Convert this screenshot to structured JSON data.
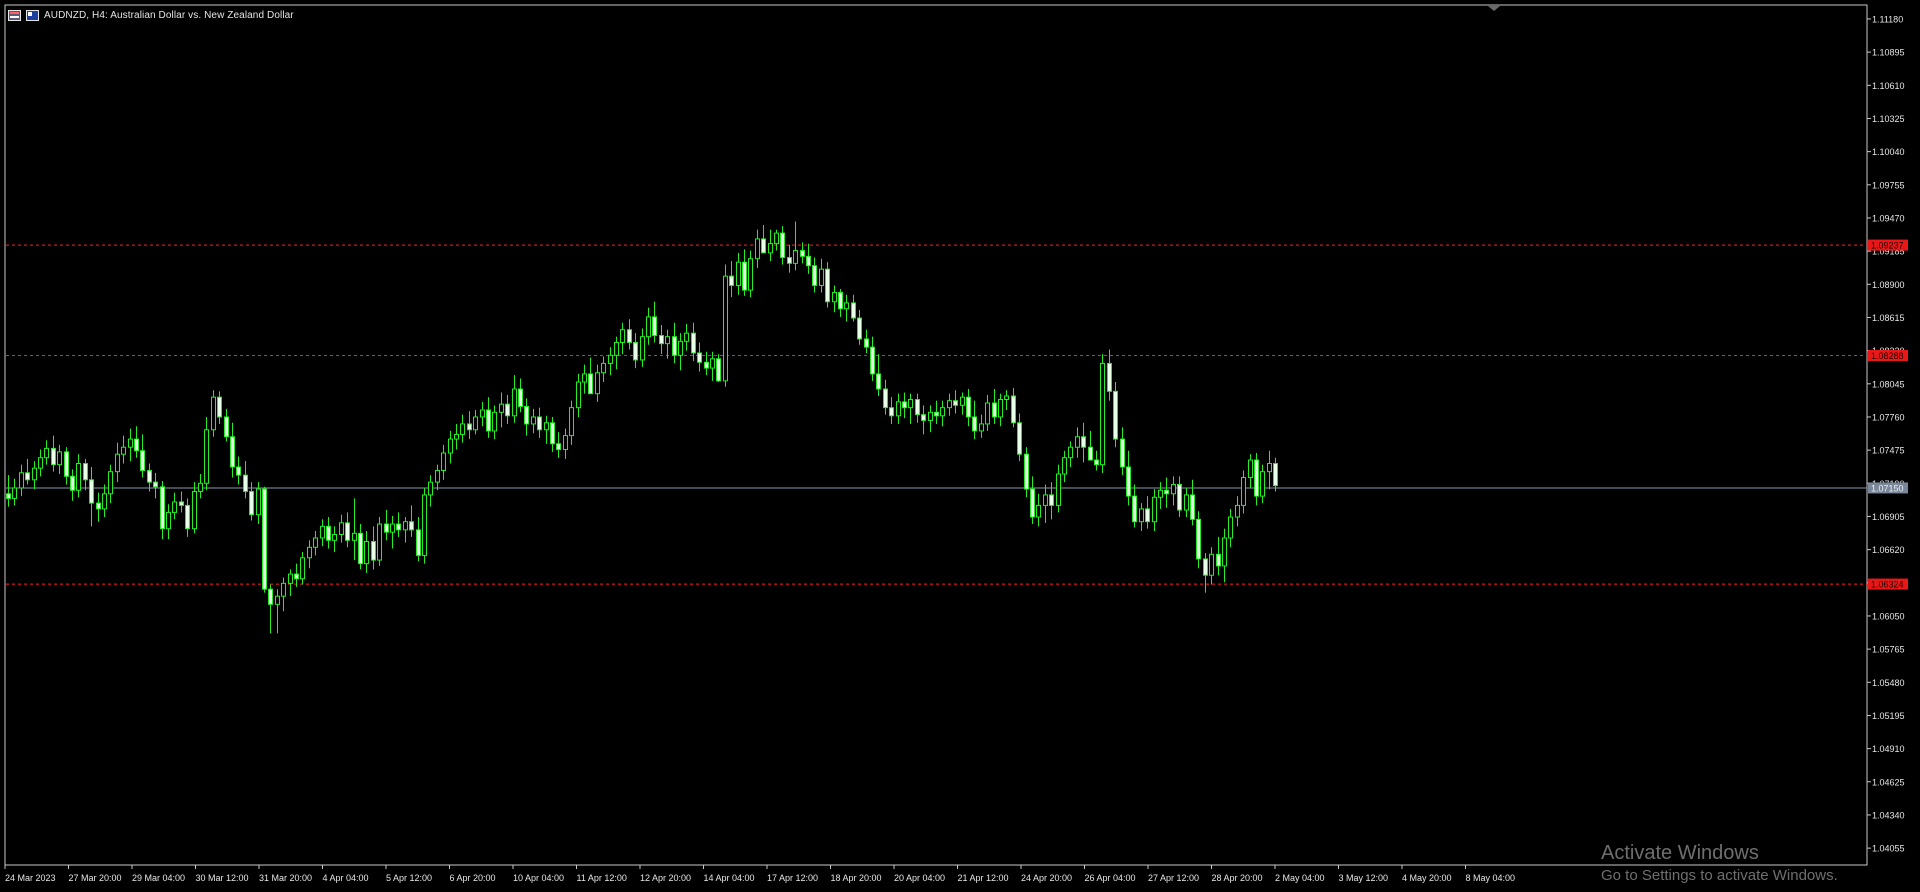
{
  "header": {
    "title": "AUDNZD, H4:  Australian Dollar vs. New Zealand Dollar",
    "icons": [
      "chart-window-icon",
      "symbol-icon"
    ]
  },
  "watermark": {
    "line1": "Activate Windows",
    "line2": "Go to Settings to activate Windows."
  },
  "colors": {
    "background": "#000000",
    "frame": "#c8c8c8",
    "candle": "#22ee22",
    "candle_up_fill": "#000000",
    "candle_down_fill": "#e8ffe8",
    "level_line": "#ff1f1f",
    "bid_line": "#8899aa"
  },
  "chart_data": {
    "type": "candlestick",
    "symbol": "AUDNZD",
    "timeframe": "H4",
    "ylim": [
      1.0391,
      1.113
    ],
    "y_ticks": [
      "1.11180",
      "1.10895",
      "1.10610",
      "1.10325",
      "1.10040",
      "1.09755",
      "1.09470",
      "1.09185",
      "1.08900",
      "1.08615",
      "1.08330",
      "1.08045",
      "1.07760",
      "1.07475",
      "1.07190",
      "1.06905",
      "1.06620",
      "1.06335",
      "1.06050",
      "1.05765",
      "1.05480",
      "1.05195",
      "1.04910",
      "1.04625",
      "1.04340",
      "1.04055"
    ],
    "x_ticks": [
      "24 Mar 2023",
      "27 Mar 20:00",
      "29 Mar 04:00",
      "30 Mar 12:00",
      "31 Mar 20:00",
      "4 Apr 04:00",
      "5 Apr 12:00",
      "6 Apr 20:00",
      "10 Apr 04:00",
      "11 Apr 12:00",
      "12 Apr 20:00",
      "14 Apr 04:00",
      "17 Apr 12:00",
      "18 Apr 20:00",
      "20 Apr 04:00",
      "21 Apr 12:00",
      "24 Apr 20:00",
      "26 Apr 04:00",
      "27 Apr 12:00",
      "28 Apr 20:00",
      "2 May 04:00",
      "3 May 12:00",
      "4 May 20:00",
      "8 May 04:00"
    ],
    "current_price": "1.07150",
    "levels": [
      {
        "label": "1.09237",
        "value": 1.09237
      },
      {
        "label": "1.08288",
        "value": 1.08288
      },
      {
        "label": "1.06324",
        "value": 1.06324
      }
    ],
    "candles": [
      [
        1.071,
        1.0726,
        1.0699,
        1.0706
      ],
      [
        1.0706,
        1.0723,
        1.07,
        1.0715
      ],
      [
        1.0715,
        1.0735,
        1.0708,
        1.0728
      ],
      [
        1.0728,
        1.074,
        1.0718,
        1.0722
      ],
      [
        1.0722,
        1.0738,
        1.0714,
        1.0732
      ],
      [
        1.0732,
        1.0748,
        1.0725,
        1.0741
      ],
      [
        1.0741,
        1.0756,
        1.0735,
        1.0749
      ],
      [
        1.0749,
        1.076,
        1.0729,
        1.0735
      ],
      [
        1.0735,
        1.0752,
        1.0727,
        1.0746
      ],
      [
        1.0746,
        1.075,
        1.0718,
        1.0725
      ],
      [
        1.0725,
        1.0731,
        1.0704,
        1.0713
      ],
      [
        1.0713,
        1.0744,
        1.0707,
        1.0736
      ],
      [
        1.0736,
        1.074,
        1.0713,
        1.0722
      ],
      [
        1.0722,
        1.0733,
        1.0682,
        1.0702
      ],
      [
        1.0702,
        1.0711,
        1.0686,
        1.0697
      ],
      [
        1.0697,
        1.0718,
        1.069,
        1.071
      ],
      [
        1.071,
        1.0735,
        1.0702,
        1.0729
      ],
      [
        1.0729,
        1.0754,
        1.072,
        1.0744
      ],
      [
        1.0744,
        1.076,
        1.0736,
        1.075
      ],
      [
        1.075,
        1.0766,
        1.0738,
        1.0757
      ],
      [
        1.0757,
        1.0768,
        1.0741,
        1.0747
      ],
      [
        1.0747,
        1.0761,
        1.0724,
        1.073
      ],
      [
        1.073,
        1.0736,
        1.0712,
        1.072
      ],
      [
        1.072,
        1.0728,
        1.0706,
        1.0716
      ],
      [
        1.0716,
        1.0721,
        1.0671,
        1.068
      ],
      [
        1.068,
        1.0701,
        1.0671,
        1.0694
      ],
      [
        1.0694,
        1.0711,
        1.0688,
        1.0703
      ],
      [
        1.0703,
        1.0712,
        1.0694,
        1.07
      ],
      [
        1.07,
        1.0706,
        1.0673,
        1.068
      ],
      [
        1.068,
        1.072,
        1.0676,
        1.0712
      ],
      [
        1.0712,
        1.0727,
        1.0706,
        1.0719
      ],
      [
        1.0719,
        1.0776,
        1.0713,
        1.0765
      ],
      [
        1.0765,
        1.0799,
        1.0759,
        1.0793
      ],
      [
        1.0793,
        1.0798,
        1.077,
        1.0776
      ],
      [
        1.0776,
        1.0783,
        1.0755,
        1.0759
      ],
      [
        1.0759,
        1.0771,
        1.0724,
        1.0733
      ],
      [
        1.0733,
        1.0742,
        1.0718,
        1.0726
      ],
      [
        1.0726,
        1.0738,
        1.0706,
        1.0712
      ],
      [
        1.0712,
        1.072,
        1.0687,
        1.0692
      ],
      [
        1.0692,
        1.072,
        1.0684,
        1.0714
      ],
      [
        1.0714,
        1.0716,
        1.0625,
        1.0628
      ],
      [
        1.0628,
        1.0632,
        1.059,
        1.0615
      ],
      [
        1.0615,
        1.0628,
        1.059,
        1.0622
      ],
      [
        1.0622,
        1.0638,
        1.0609,
        1.0633
      ],
      [
        1.0633,
        1.0645,
        1.0622,
        1.0641
      ],
      [
        1.0641,
        1.065,
        1.063,
        1.0637
      ],
      [
        1.0637,
        1.066,
        1.0632,
        1.0655
      ],
      [
        1.0655,
        1.067,
        1.0646,
        1.0664
      ],
      [
        1.0664,
        1.0678,
        1.0657,
        1.0672
      ],
      [
        1.0672,
        1.0688,
        1.0665,
        1.0682
      ],
      [
        1.0682,
        1.069,
        1.0663,
        1.067
      ],
      [
        1.067,
        1.0682,
        1.066,
        1.0675
      ],
      [
        1.0675,
        1.0692,
        1.0668,
        1.0685
      ],
      [
        1.0685,
        1.0694,
        1.0664,
        1.067
      ],
      [
        1.067,
        1.0706,
        1.0653,
        1.0676
      ],
      [
        1.0676,
        1.0684,
        1.0645,
        1.065
      ],
      [
        1.065,
        1.0678,
        1.0642,
        1.0669
      ],
      [
        1.0669,
        1.0682,
        1.0645,
        1.0653
      ],
      [
        1.0653,
        1.069,
        1.0648,
        1.0684
      ],
      [
        1.0684,
        1.0696,
        1.067,
        1.0677
      ],
      [
        1.0677,
        1.0691,
        1.0663,
        1.0684
      ],
      [
        1.0684,
        1.0694,
        1.0673,
        1.0679
      ],
      [
        1.0679,
        1.069,
        1.0668,
        1.0686
      ],
      [
        1.0686,
        1.07,
        1.0673,
        1.0679
      ],
      [
        1.0679,
        1.069,
        1.0652,
        1.0657
      ],
      [
        1.0657,
        1.0715,
        1.065,
        1.0709
      ],
      [
        1.0709,
        1.0726,
        1.0699,
        1.072
      ],
      [
        1.072,
        1.0735,
        1.0713,
        1.073
      ],
      [
        1.073,
        1.0752,
        1.0722,
        1.0745
      ],
      [
        1.0745,
        1.0764,
        1.0736,
        1.0757
      ],
      [
        1.0757,
        1.077,
        1.0748,
        1.0761
      ],
      [
        1.0761,
        1.0778,
        1.0754,
        1.077
      ],
      [
        1.077,
        1.0781,
        1.0757,
        1.0765
      ],
      [
        1.0765,
        1.0782,
        1.0761,
        1.0776
      ],
      [
        1.0776,
        1.0789,
        1.0768,
        1.0782
      ],
      [
        1.0782,
        1.0793,
        1.0758,
        1.0764
      ],
      [
        1.0764,
        1.0786,
        1.0757,
        1.078
      ],
      [
        1.078,
        1.0797,
        1.0767,
        1.0787
      ],
      [
        1.0787,
        1.0795,
        1.077,
        1.0777
      ],
      [
        1.0777,
        1.0812,
        1.0771,
        1.08
      ],
      [
        1.08,
        1.0809,
        1.078,
        1.0785
      ],
      [
        1.0785,
        1.0792,
        1.076,
        1.077
      ],
      [
        1.077,
        1.0783,
        1.0762,
        1.0776
      ],
      [
        1.0776,
        1.0784,
        1.0758,
        1.0765
      ],
      [
        1.0765,
        1.0777,
        1.0753,
        1.0771
      ],
      [
        1.0771,
        1.0776,
        1.0746,
        1.0753
      ],
      [
        1.0753,
        1.0763,
        1.0741,
        1.0748
      ],
      [
        1.0748,
        1.0766,
        1.074,
        1.076
      ],
      [
        1.076,
        1.079,
        1.0752,
        1.0784
      ],
      [
        1.0784,
        1.0813,
        1.0776,
        1.0806
      ],
      [
        1.0806,
        1.0821,
        1.0796,
        1.0813
      ],
      [
        1.0813,
        1.0827,
        1.0805,
        1.0796
      ],
      [
        1.0796,
        1.0821,
        1.0789,
        1.0814
      ],
      [
        1.0814,
        1.0828,
        1.0806,
        1.0822
      ],
      [
        1.0822,
        1.0836,
        1.0812,
        1.0829
      ],
      [
        1.0829,
        1.0845,
        1.0817,
        1.084
      ],
      [
        1.084,
        1.0857,
        1.083,
        1.0851
      ],
      [
        1.0851,
        1.086,
        1.0834,
        1.084
      ],
      [
        1.084,
        1.0848,
        1.0818,
        1.0825
      ],
      [
        1.0825,
        1.0852,
        1.0819,
        1.0845
      ],
      [
        1.0845,
        1.087,
        1.0838,
        1.0862
      ],
      [
        1.0862,
        1.0875,
        1.084,
        1.0846
      ],
      [
        1.0846,
        1.0855,
        1.083,
        1.0839
      ],
      [
        1.0839,
        1.0851,
        1.0826,
        1.0845
      ],
      [
        1.0845,
        1.0857,
        1.0822,
        1.0829
      ],
      [
        1.0829,
        1.0848,
        1.0816,
        1.0841
      ],
      [
        1.0841,
        1.0856,
        1.0833,
        1.0848
      ],
      [
        1.0848,
        1.0857,
        1.0824,
        1.0831
      ],
      [
        1.0831,
        1.084,
        1.0815,
        1.0823
      ],
      [
        1.0823,
        1.0832,
        1.0812,
        1.0818
      ],
      [
        1.0818,
        1.0832,
        1.0807,
        1.0826
      ],
      [
        1.0826,
        1.083,
        1.0806,
        1.0807
      ],
      [
        1.0807,
        1.0907,
        1.0802,
        1.0897
      ],
      [
        1.0897,
        1.091,
        1.0879,
        1.0889
      ],
      [
        1.0889,
        1.0917,
        1.0881,
        1.0909
      ],
      [
        1.0909,
        1.092,
        1.088,
        1.0885
      ],
      [
        1.0885,
        1.0919,
        1.0879,
        1.0912
      ],
      [
        1.0912,
        1.0937,
        1.0904,
        1.0929
      ],
      [
        1.0929,
        1.0941,
        1.0917,
        1.0917
      ],
      [
        1.0917,
        1.0937,
        1.091,
        1.0925
      ],
      [
        1.0925,
        1.0937,
        1.0919,
        1.0934
      ],
      [
        1.0934,
        1.094,
        1.0907,
        1.0913
      ],
      [
        1.0913,
        1.0924,
        1.09,
        1.0908
      ],
      [
        1.0908,
        1.0944,
        1.0902,
        1.0919
      ],
      [
        1.0919,
        1.0926,
        1.0908,
        1.0914
      ],
      [
        1.0914,
        1.0925,
        1.0899,
        1.0906
      ],
      [
        1.0906,
        1.0913,
        1.0883,
        1.0889
      ],
      [
        1.0889,
        1.0912,
        1.0883,
        1.0903
      ],
      [
        1.0903,
        1.0909,
        1.087,
        1.0875
      ],
      [
        1.0875,
        1.0889,
        1.0866,
        1.0883
      ],
      [
        1.0883,
        1.0886,
        1.0862,
        1.0869
      ],
      [
        1.0869,
        1.0881,
        1.0858,
        1.0874
      ],
      [
        1.0874,
        1.0881,
        1.0858,
        1.0861
      ],
      [
        1.0861,
        1.0868,
        1.0838,
        1.0843
      ],
      [
        1.0843,
        1.0851,
        1.0831,
        1.0836
      ],
      [
        1.0836,
        1.0845,
        1.0807,
        1.0813
      ],
      [
        1.0813,
        1.083,
        1.0794,
        1.08
      ],
      [
        1.08,
        1.0808,
        1.0778,
        1.0784
      ],
      [
        1.0784,
        1.0793,
        1.077,
        1.0777
      ],
      [
        1.0777,
        1.0796,
        1.077,
        1.0789
      ],
      [
        1.0789,
        1.0797,
        1.0775,
        1.0784
      ],
      [
        1.0784,
        1.0796,
        1.077,
        1.0791
      ],
      [
        1.0791,
        1.0796,
        1.0771,
        1.0778
      ],
      [
        1.0778,
        1.0786,
        1.0761,
        1.0773
      ],
      [
        1.0773,
        1.0786,
        1.0763,
        1.078
      ],
      [
        1.078,
        1.079,
        1.077,
        1.0777
      ],
      [
        1.0777,
        1.079,
        1.0768,
        1.0784
      ],
      [
        1.0784,
        1.0796,
        1.0777,
        1.079
      ],
      [
        1.079,
        1.0799,
        1.0779,
        1.0786
      ],
      [
        1.0786,
        1.0797,
        1.0778,
        1.0793
      ],
      [
        1.0793,
        1.08,
        1.0768,
        1.0776
      ],
      [
        1.0776,
        1.079,
        1.0757,
        1.0764
      ],
      [
        1.0764,
        1.0778,
        1.0758,
        1.077
      ],
      [
        1.077,
        1.0795,
        1.0764,
        1.0788
      ],
      [
        1.0788,
        1.08,
        1.077,
        1.0776
      ],
      [
        1.0776,
        1.0796,
        1.0768,
        1.0791
      ],
      [
        1.0791,
        1.0799,
        1.0782,
        1.0794
      ],
      [
        1.0794,
        1.0801,
        1.0767,
        1.0771
      ],
      [
        1.0771,
        1.0779,
        1.0738,
        1.0744
      ],
      [
        1.0744,
        1.075,
        1.0707,
        1.0714
      ],
      [
        1.0714,
        1.0725,
        1.0684,
        1.069
      ],
      [
        1.069,
        1.071,
        1.0682,
        1.07
      ],
      [
        1.07,
        1.0718,
        1.0685,
        1.0709
      ],
      [
        1.0709,
        1.072,
        1.0688,
        1.07
      ],
      [
        1.07,
        1.0735,
        1.0694,
        1.0727
      ],
      [
        1.0727,
        1.0747,
        1.072,
        1.0741
      ],
      [
        1.0741,
        1.0755,
        1.0733,
        1.075
      ],
      [
        1.075,
        1.0767,
        1.0741,
        1.0759
      ],
      [
        1.0759,
        1.0771,
        1.0737,
        1.075
      ],
      [
        1.075,
        1.0764,
        1.074,
        1.0739
      ],
      [
        1.0739,
        1.0747,
        1.073,
        1.0735
      ],
      [
        1.0735,
        1.083,
        1.0728,
        1.0822
      ],
      [
        1.0822,
        1.0834,
        1.079,
        1.0798
      ],
      [
        1.0798,
        1.0806,
        1.075,
        1.0757
      ],
      [
        1.0757,
        1.0767,
        1.0726,
        1.0733
      ],
      [
        1.0733,
        1.0747,
        1.07,
        1.0708
      ],
      [
        1.0708,
        1.0718,
        1.0681,
        1.0686
      ],
      [
        1.0686,
        1.0702,
        1.0678,
        1.0697
      ],
      [
        1.0697,
        1.0708,
        1.068,
        1.0686
      ],
      [
        1.0686,
        1.0714,
        1.0678,
        1.0707
      ],
      [
        1.0707,
        1.072,
        1.0697,
        1.0713
      ],
      [
        1.0713,
        1.0724,
        1.0698,
        1.071
      ],
      [
        1.071,
        1.0725,
        1.07,
        1.0718
      ],
      [
        1.0718,
        1.0725,
        1.069,
        1.0696
      ],
      [
        1.0696,
        1.0715,
        1.069,
        1.0709
      ],
      [
        1.0709,
        1.0722,
        1.0683,
        1.0688
      ],
      [
        1.0688,
        1.0695,
        1.0646,
        1.0654
      ],
      [
        1.0654,
        1.0659,
        1.0625,
        1.064
      ],
      [
        1.064,
        1.0664,
        1.0632,
        1.0658
      ],
      [
        1.0658,
        1.0673,
        1.064,
        1.0648
      ],
      [
        1.0648,
        1.068,
        1.0634,
        1.0672
      ],
      [
        1.0672,
        1.0697,
        1.0664,
        1.069
      ],
      [
        1.069,
        1.0708,
        1.0682,
        1.07
      ],
      [
        1.07,
        1.073,
        1.0693,
        1.0724
      ],
      [
        1.0724,
        1.0744,
        1.0715,
        1.0739
      ],
      [
        1.0739,
        1.0745,
        1.07,
        1.0708
      ],
      [
        1.0708,
        1.0735,
        1.0702,
        1.0729
      ],
      [
        1.0729,
        1.0747,
        1.0714,
        1.0736
      ],
      [
        1.0736,
        1.0741,
        1.0712,
        1.0717
      ]
    ]
  }
}
